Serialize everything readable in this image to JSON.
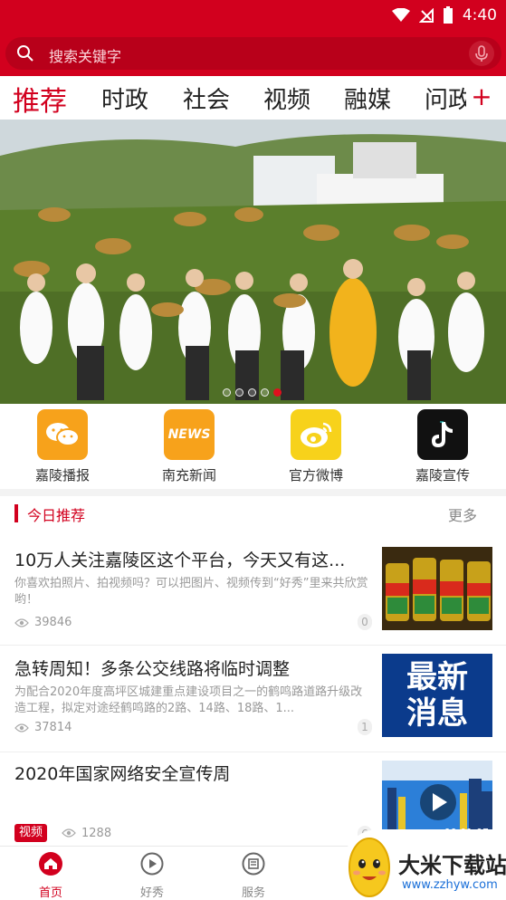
{
  "status": {
    "time": "4:40"
  },
  "search": {
    "placeholder": "搜索关键字"
  },
  "tabs": [
    "推荐",
    "时政",
    "社会",
    "视频",
    "融媒",
    "问政"
  ],
  "tab_add": "+",
  "quick_links": [
    {
      "label": "嘉陵播报",
      "icon": "wechat-icon"
    },
    {
      "label": "南充新闻",
      "icon": "news-icon",
      "badge": "NEWS"
    },
    {
      "label": "官方微博",
      "icon": "weibo-icon"
    },
    {
      "label": "嘉陵宣传",
      "icon": "tiktok-icon"
    }
  ],
  "section": {
    "title": "今日推荐",
    "more": "更多"
  },
  "news": [
    {
      "title": "10万人关注嘉陵区这个平台，今天又有这...",
      "summary": "你喜欢拍照片、拍视频吗？可以把图片、视频传到“好秀”里来共欣赏哟！",
      "views": "39846",
      "comments": "0"
    },
    {
      "title": "急转周知！多条公交线路将临时调整",
      "summary": "为配合2020年度高坪区城建重点建设项目之一的鹤鸣路道路升级改造工程，拟定对途经鹤鸣路的2路、14路、18路、1...",
      "views": "37814",
      "comments": "1",
      "thumb_text_1": "最新",
      "thumb_text_2": "消息"
    },
    {
      "title": "2020年国家网络安全宣传周",
      "tag": "视频",
      "views": "1288",
      "comments": "6",
      "duration": "00:01:07"
    }
  ],
  "bottom_nav": [
    {
      "label": "首页",
      "icon": "home-icon",
      "active": true
    },
    {
      "label": "好秀",
      "icon": "play-icon"
    },
    {
      "label": "服务",
      "icon": "service-icon"
    }
  ],
  "watermark": {
    "name": "大米下载站",
    "url": "www.zzhyw.com"
  },
  "colors": {
    "brand": "#d2001e"
  }
}
